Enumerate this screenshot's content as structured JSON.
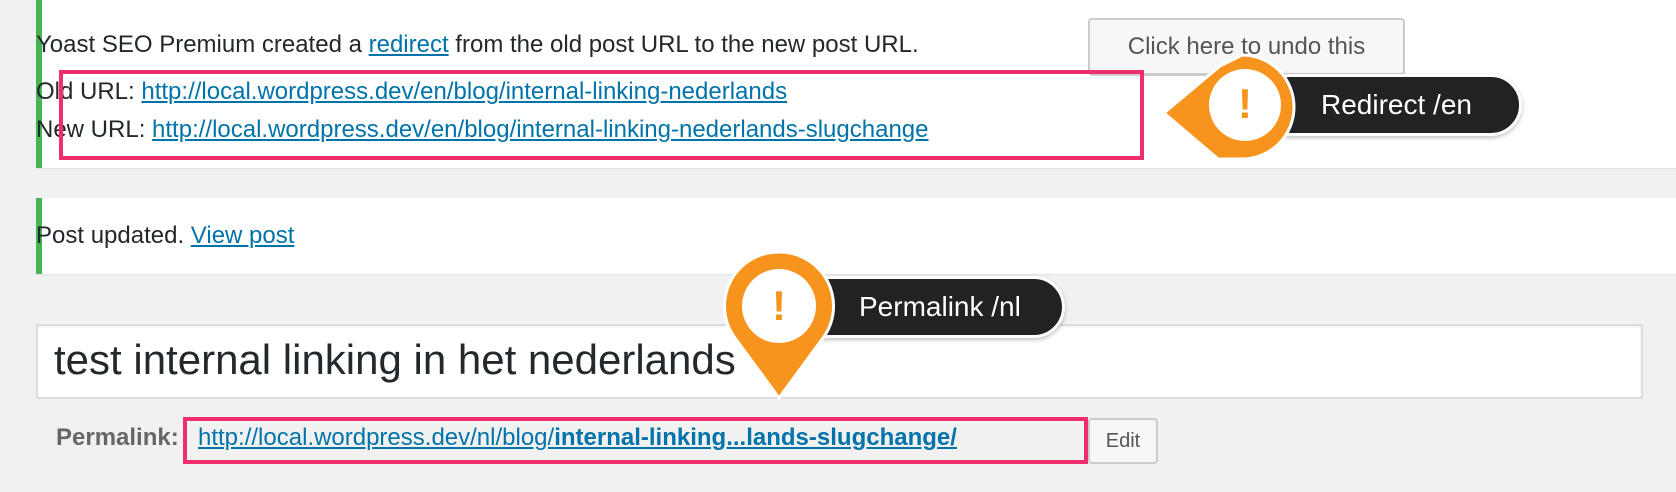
{
  "redirect_notice": {
    "text_before": "Yoast SEO Premium created a ",
    "link_text": "redirect",
    "text_after": " from the old post URL to the new post URL.",
    "undo_label": "Click here to undo this",
    "old_url_label": "Old URL: ",
    "old_url": "http://local.wordpress.dev/en/blog/internal-linking-nederlands",
    "new_url_label": "New URL: ",
    "new_url": "http://local.wordpress.dev/en/blog/internal-linking-nederlands-slugchange"
  },
  "updated_notice": {
    "text": "Post updated. ",
    "link_text": "View post"
  },
  "post": {
    "title": "test internal linking in het nederlands",
    "permalink_label": "Permalink:",
    "permalink_base": "http://local.wordpress.dev/nl/blog/",
    "permalink_slug": "internal-linking...lands-slugchange/",
    "edit_label": "Edit"
  },
  "annotations": {
    "redirect_bubble": "Redirect /en",
    "permalink_bubble": "Permalink /nl",
    "marker_glyph": "!"
  },
  "colors": {
    "notice_success": "#46b450",
    "link": "#0073aa",
    "highlight": "#ee2f6b",
    "marker": "#f7941d",
    "bubble": "#222222"
  }
}
